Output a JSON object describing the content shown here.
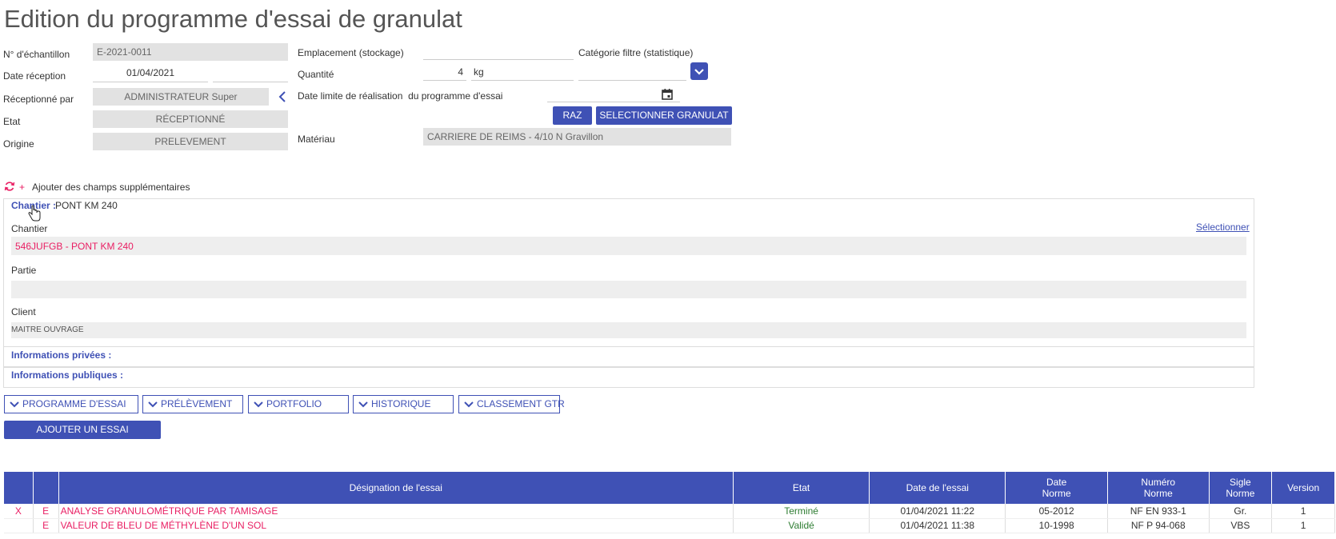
{
  "page_title": "Edition du programme d'essai de granulat",
  "form_left": {
    "sample_label": "N° d'échantillon",
    "sample_value": "E-2021-0011",
    "date_label": "Date réception",
    "date_value": "01/04/2021",
    "received_label": "Réceptionné par",
    "received_value": "ADMINISTRATEUR Super",
    "state_label": "Etat",
    "state_value": "RÉCEPTIONNÉ",
    "origin_label": "Origine",
    "origin_value": "PRELEVEMENT"
  },
  "form_mid": {
    "location_label": "Emplacement (stockage)",
    "location_value": "",
    "quantity_label": "Quantité",
    "quantity_value": "4",
    "quantity_unit": "kg",
    "deadline_label": "Date limite de réalisation  du programme d'essai",
    "material_label": "Matériau",
    "material_value": "CARRIERE DE REIMS - 4/10 N Gravillon"
  },
  "form_right": {
    "category_label": "Catégorie filtre (statistique)",
    "category_value": ""
  },
  "buttons": {
    "raz": "RAZ",
    "select_granulat": "SELECTIONNER GRANULAT",
    "add_test": "AJOUTER UN ESSAI"
  },
  "extra_fields": {
    "plus": "+",
    "label": "Ajouter des champs supplémentaires"
  },
  "chantier_panel": {
    "header_label": "Chantier :",
    "header_value": "PONT KM 240",
    "select_link": "Sélectionner",
    "chantier_label": "Chantier",
    "chantier_value": "546JUFGB - PONT KM 240",
    "partie_label": "Partie",
    "partie_value": "",
    "client_label": "Client",
    "client_value": "MAITRE OUVRAGE"
  },
  "info_private": "Informations privées :",
  "info_public": "Informations publiques :",
  "tabs": [
    "PROGRAMME D'ESSAI",
    "PRÉLÈVEMENT",
    "PORTFOLIO",
    "HISTORIQUE",
    "CLASSEMENT GTR"
  ],
  "table": {
    "headers": {
      "designation": "Désignation de l'essai",
      "etat": "Etat",
      "date_essai": "Date de l'essai",
      "date_norme_1": "Date",
      "date_norme_2": "Norme",
      "numero_norme_1": "Numéro",
      "numero_norme_2": "Norme",
      "sigle_norme_1": "Sigle",
      "sigle_norme_2": "Norme",
      "version": "Version"
    },
    "rows": [
      {
        "x": "X",
        "e": "E",
        "designation": "ANALYSE GRANULOMÉTRIQUE PAR TAMISAGE",
        "etat": "Terminé",
        "date": "01/04/2021 11:22",
        "date_norme": "05-2012",
        "numero_norme": "NF EN 933-1",
        "sigle": "Gr.",
        "version": "1"
      },
      {
        "x": "",
        "e": "E",
        "designation": "VALEUR DE BLEU DE MÉTHYLÈNE D'UN SOL",
        "etat": "Validé",
        "date": "01/04/2021 11:38",
        "date_norme": "10-1998",
        "numero_norme": "NF P 94-068",
        "sigle": "VBS",
        "version": "1"
      }
    ]
  },
  "colors": {
    "primary": "#3f51b5",
    "accent_pink": "#e91e63",
    "status_green": "#2e7d32",
    "field_grey": "#e2e2e2"
  }
}
